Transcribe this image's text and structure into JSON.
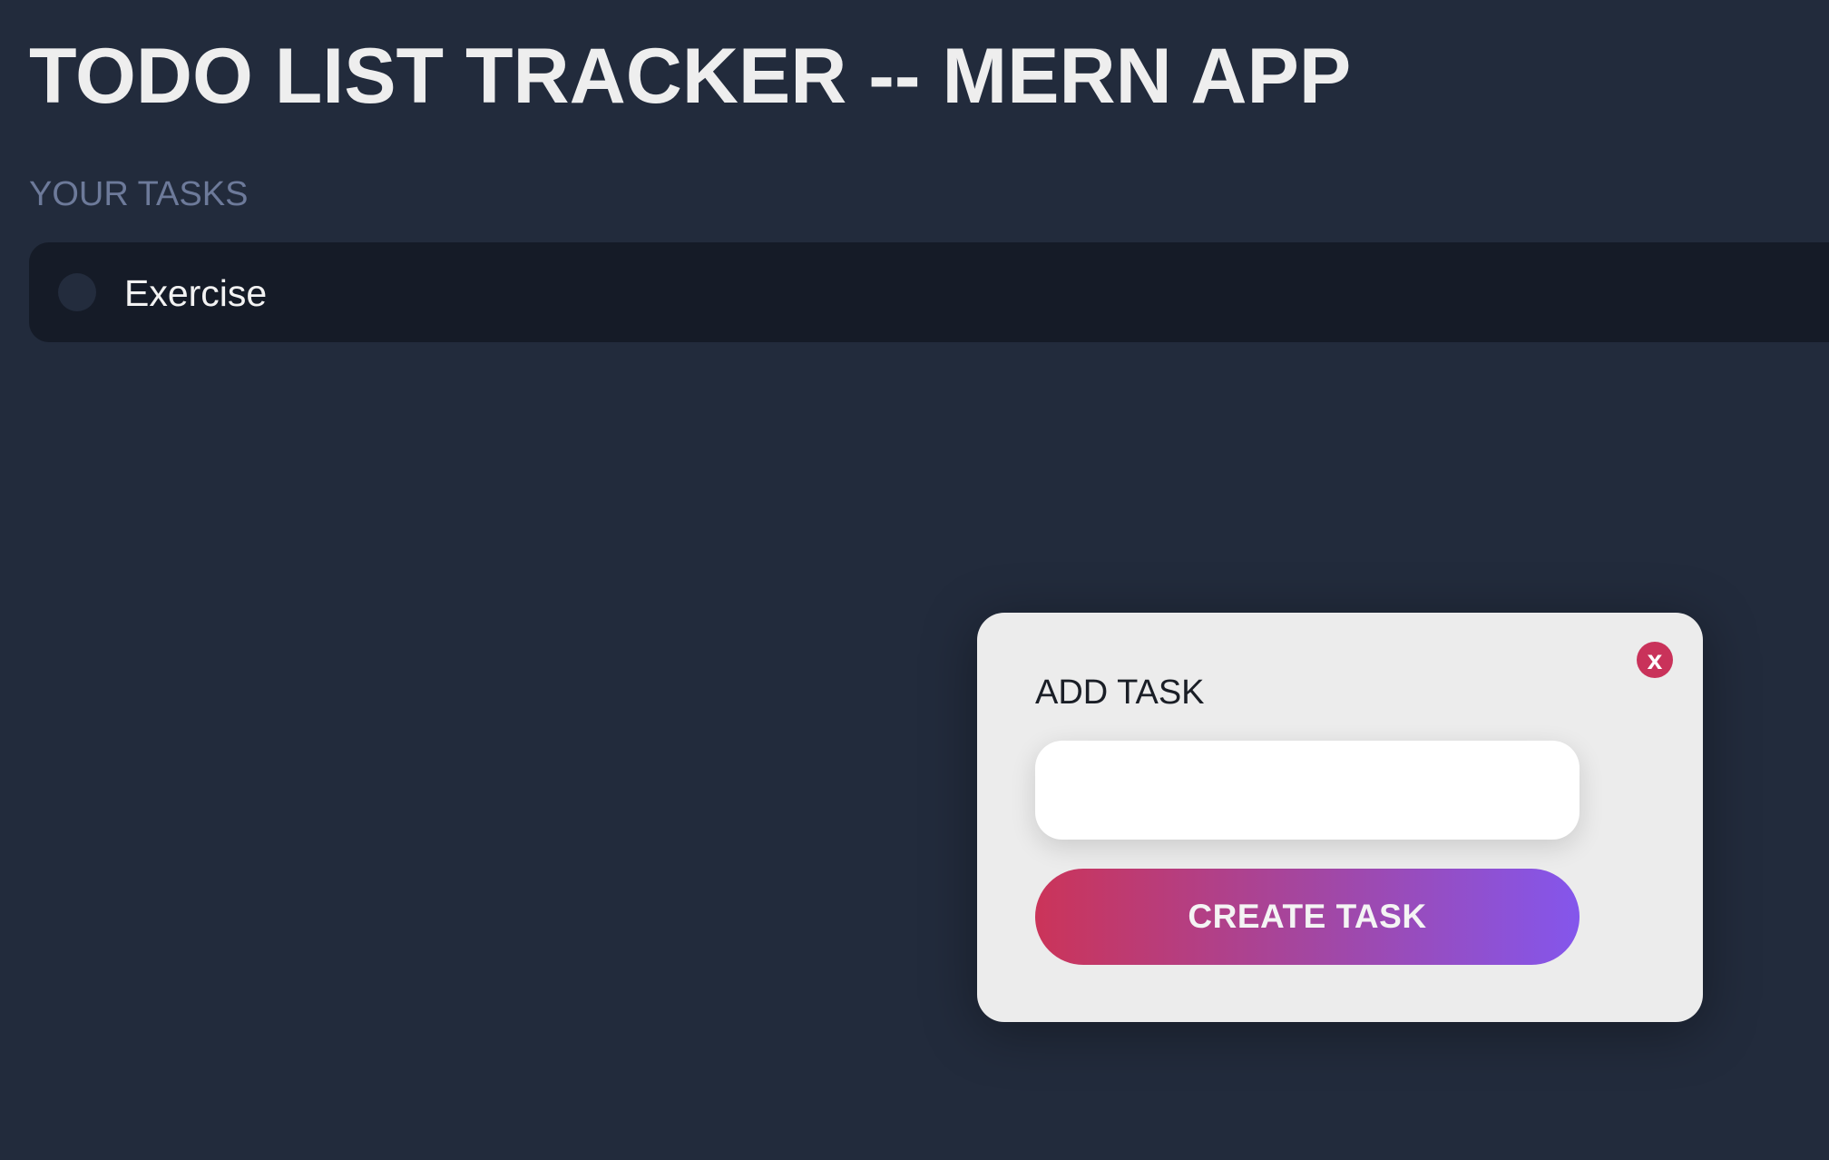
{
  "app": {
    "title": "TODO LIST TRACKER -- MERN APP"
  },
  "tasks_section": {
    "label": "YOUR TASKS",
    "items": [
      {
        "label": "Exercise",
        "completed": false
      }
    ]
  },
  "modal": {
    "title": "ADD TASK",
    "close_label": "x",
    "input": {
      "value": "",
      "placeholder": ""
    },
    "submit_label": "CREATE TASK"
  },
  "colors": {
    "background": "#222b3c",
    "task_row": "#151b27",
    "modal_background": "#ececec",
    "close_button": "#c9325a",
    "button_gradient_start": "#cb3459",
    "button_gradient_end": "#8456ec",
    "section_label": "#6d7a9a"
  },
  "icons": {
    "task_checkbox": "circle-checkbox-icon",
    "close": "close-icon"
  }
}
